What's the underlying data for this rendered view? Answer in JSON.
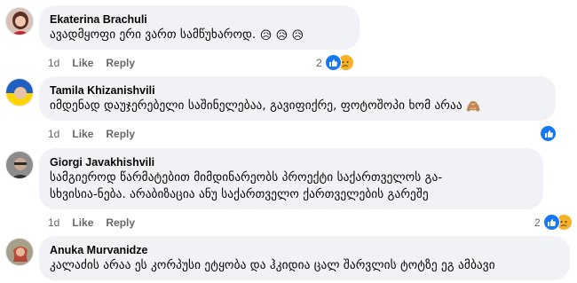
{
  "comments": [
    {
      "author": "Ekaterina Brachuli",
      "text": "ავადმყოფი ერი ვართ სამწუხაროდ.",
      "emojis": "😥 😥 😥",
      "time": "1d",
      "like_label": "Like",
      "reply_label": "Reply",
      "reaction_count": "2",
      "reactions": [
        "like",
        "sad"
      ]
    },
    {
      "author": "Tamila Khizanishvili",
      "text": "იმდენად დაუჯერებელი საშინელებაა, გავიფიქრე, ფოტოშოპი ხომ არაა",
      "emojis": "🙈",
      "time": "1d",
      "like_label": "Like",
      "reply_label": "Reply",
      "reaction_count": "",
      "reactions": [
        "like"
      ]
    },
    {
      "author": "Giorgi Javakhishvili",
      "text_line1": "სამგიეროდ წარმატებით მიმდინარეობს პროექტი საქართველოს გა-",
      "text_line2": "სხვისია-ნება. არაბიზაცია ანუ საქართველო ქართველების გარეშე",
      "time": "1d",
      "like_label": "Like",
      "reply_label": "Reply",
      "reaction_count": "2",
      "reactions": [
        "like",
        "sad"
      ]
    },
    {
      "author": "Anuka Murvanidze",
      "text": "კალაძის არაა ეს კორპუსი ეტყობა და ჰკიდია ცალ შარვლის ტოტზე ეგ ამბავი"
    }
  ],
  "colors": {
    "bubble": "#f0f2f5",
    "like_blue": "#1877f2",
    "sad_yellow": "#f7b125",
    "meta_gray": "#65676b"
  }
}
